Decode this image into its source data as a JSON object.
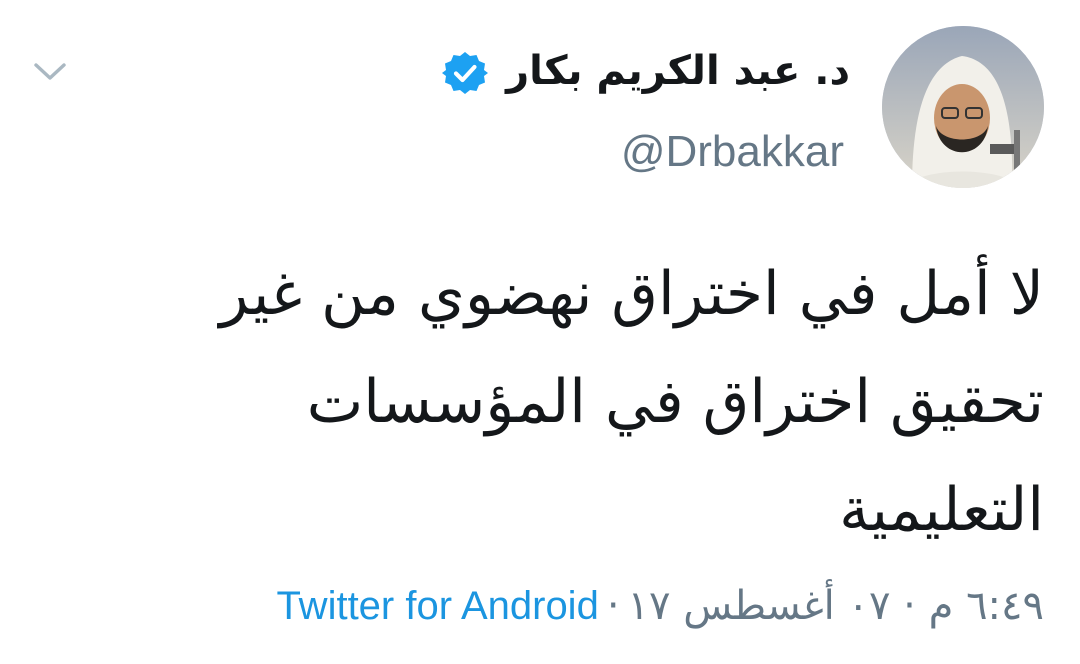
{
  "tweet": {
    "author": {
      "display_name": "د. عبد الكريم بكار",
      "handle": "@Drbakkar",
      "verified": true,
      "avatar_icon": "profile-photo"
    },
    "text": "لا أمل في اختراق نهضوي من غير تحقيق اختراق في المؤسسات التعليمية",
    "timestamp": "٦:٤٩ م · ٠٧ أغسطس ١٧",
    "separator": "·",
    "source": "Twitter for Android",
    "menu_icon": "chevron-down-icon"
  },
  "colors": {
    "text_primary": "#14171a",
    "text_secondary": "#657786",
    "link": "#1b95e0",
    "verified_badge": "#1da1f2",
    "chevron": "#aab8c2"
  }
}
